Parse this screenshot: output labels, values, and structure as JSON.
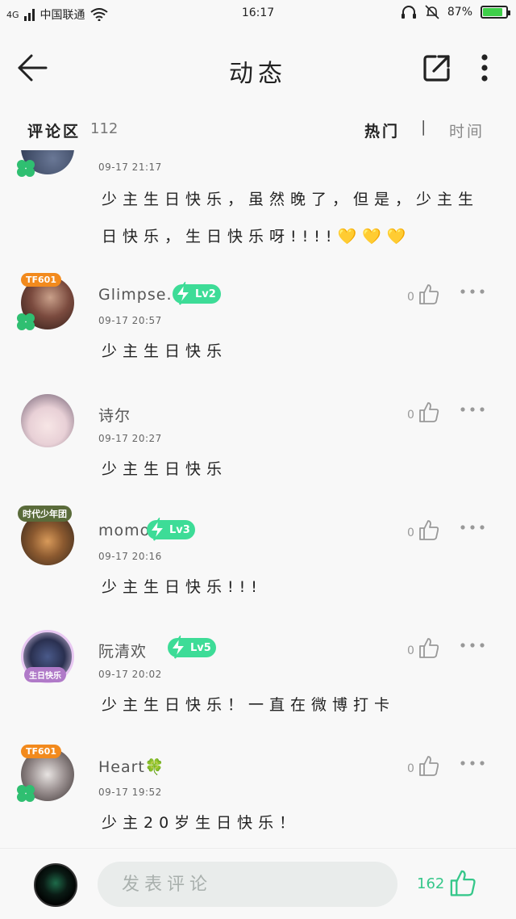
{
  "status_bar": {
    "network": "4G",
    "carrier": "中国联通",
    "time": "16:17",
    "battery": "87%",
    "battery_level": 0.87
  },
  "header": {
    "title": "动态"
  },
  "comment_section": {
    "label": "评论区",
    "count": "112",
    "sort_hot": "热门",
    "separator": "|",
    "sort_time": "时间"
  },
  "comments": [
    {
      "user": "",
      "level": "",
      "time": "09-17 21:17",
      "text": "少主生日快乐，虽然晚了，但是，少主生日快乐，生日快乐呀!!!!💛💛💛",
      "likes": ""
    },
    {
      "user": "Glimpse.",
      "level": "Lv2",
      "frame": "TF601",
      "time": "09-17 20:57",
      "text": "少主生日快乐",
      "likes": "0"
    },
    {
      "user": "诗尔",
      "level": "",
      "time": "09-17 20:27",
      "text": "少主生日快乐",
      "likes": "0"
    },
    {
      "user": "momo",
      "level": "Lv3",
      "frame": "时代少年团",
      "time": "09-17 20:16",
      "text": "少主生日快乐!!!",
      "likes": "0"
    },
    {
      "user": "阮清欢",
      "level": "Lv5",
      "frame": "生日快乐",
      "time": "09-17 20:02",
      "text": "少主生日快乐！一直在微博打卡",
      "likes": "0"
    },
    {
      "user": "Heart🍀",
      "level": "",
      "frame": "TF601",
      "time": "09-17 19:52",
      "text": "少主20岁生日快乐！",
      "likes": "0"
    }
  ],
  "bottom_bar": {
    "input_placeholder": "发表评论",
    "total_likes": "162"
  },
  "colors": {
    "accent": "#36c78a",
    "level_badge": "#3ddc97",
    "frame_orange": "#f28a1d"
  },
  "icons": [
    "back-arrow-icon",
    "share-icon",
    "more-vertical-icon",
    "thumbs-up-icon",
    "more-horizontal-icon",
    "clover-icon",
    "lightning-icon"
  ]
}
